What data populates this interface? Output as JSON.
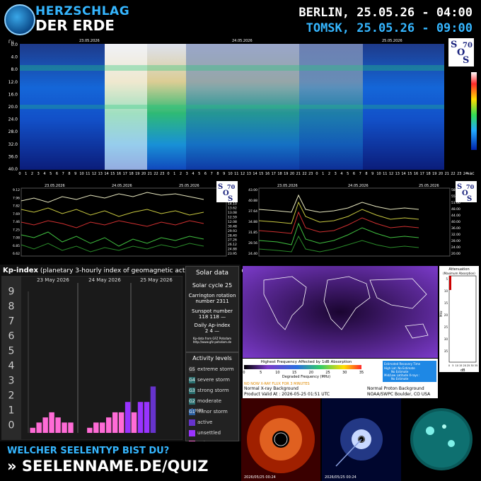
{
  "header": {
    "brand_line1": "HERZSCHLAG",
    "brand_line2": "DER ERDE",
    "berlin_time": "BERLIN, 25.05.26 - 04:00",
    "tomsk_time": "TOMSK, 25.05.26 - 09:00",
    "accent_color": "#35b6ff"
  },
  "spectrogram": {
    "y_unit": "Гц",
    "y_ticks": [
      "0.0",
      "4.0",
      "8.0",
      "12.0",
      "16.0",
      "20.0",
      "24.0",
      "28.0",
      "32.0",
      "36.0",
      "40.0"
    ],
    "x_unit": "час",
    "x_ticks": [
      "0",
      "1",
      "2",
      "3",
      "4",
      "5",
      "6",
      "7",
      "8",
      "9",
      "10",
      "11",
      "12",
      "13",
      "14",
      "15",
      "16",
      "17",
      "18",
      "19",
      "20",
      "21",
      "22",
      "23",
      "0",
      "1",
      "2",
      "3",
      "4",
      "5",
      "6",
      "7",
      "8",
      "9",
      "10",
      "11",
      "12",
      "13",
      "14",
      "15",
      "16",
      "17",
      "18",
      "19",
      "20",
      "21",
      "22",
      "23",
      "0",
      "1",
      "2",
      "3",
      "4",
      "5",
      "6",
      "7",
      "8",
      "9",
      "10",
      "11",
      "12",
      "13",
      "14",
      "15",
      "16",
      "17",
      "18",
      "19",
      "20",
      "21",
      "22",
      "23",
      "24"
    ],
    "dates": [
      "23.05.2026",
      "24.05.2026",
      "25.05.2026"
    ],
    "sos_logo": "SOS70"
  },
  "left_plot": {
    "y_left": [
      "9.12",
      "7.96",
      "7.82",
      "7.69",
      "7.46",
      "7.25",
      "7.08",
      "6.85",
      "6.62"
    ],
    "y_right": [
      "15.36",
      "15.05",
      "14.60",
      "14.10",
      "13.62",
      "13.08",
      "12.59",
      "12.08"
    ],
    "y_right2": [
      "30.48",
      "29.93",
      "28.40",
      "27.26",
      "26.12",
      "24.88",
      "23.95"
    ],
    "dates": [
      "23.05.2026",
      "24.05.2026",
      "25.05.2026"
    ]
  },
  "right_plot": {
    "y_left": [
      "43.00",
      "40.88",
      "37.64",
      "34.88",
      "31.85",
      "28.56",
      "24.40"
    ],
    "y_right": [
      "58.88",
      "55.40",
      "51.60",
      "48.00",
      "44.00",
      "40.00",
      "36.00",
      "32.00",
      "28.00",
      "24.00",
      "20.00"
    ],
    "dates": [
      "23.05.2026",
      "24.05.2026",
      "25.05.2026"
    ]
  },
  "kp": {
    "title_bold": "Kp-index",
    "title_rest": "(planetary 3-hourly index of geomagnetic activity - provisional data)",
    "levels": [
      "9",
      "8",
      "7",
      "6",
      "5",
      "4",
      "3",
      "2",
      "1",
      "0"
    ],
    "days": [
      "23 May 2026",
      "24 May 2026",
      "25 May 2026"
    ],
    "values": [
      0.33,
      0.67,
      1.0,
      1.33,
      1.0,
      0.67,
      0.67,
      0.0,
      0.0,
      0.33,
      0.67,
      0.67,
      1.0,
      1.33,
      1.33,
      2.0,
      1.33,
      2.0,
      2.0,
      3.0,
      0,
      0,
      0,
      0
    ],
    "colors": {
      "quiet": "#ff6bd6",
      "unsettled": "#9933ff",
      "active": "#6633cc"
    }
  },
  "solar": {
    "title": "Solar data",
    "cycle": "Solar cycle 25",
    "carrington": "Carrington rotation number 2311",
    "sunspot_label": "Sunspot number",
    "sunspot_vals": "118   118   —",
    "ap_label": "Daily Ap-index",
    "ap_vals": "2     4     —",
    "source": "Kp-data from GFZ Potsdam http://www.gfz-potsdam.de"
  },
  "activity": {
    "title": "Activity levels",
    "items": [
      {
        "code": "G5",
        "label": "extreme storm",
        "color": "#333"
      },
      {
        "code": "G4",
        "label": "severe storm",
        "color": "#2a6e6e"
      },
      {
        "code": "G3",
        "label": "strong storm",
        "color": "#2a6e6e"
      },
      {
        "code": "G2",
        "label": "moderate storm",
        "color": "#2a6e6e"
      },
      {
        "code": "G1",
        "label": "minor storm",
        "color": "#2a5e9e"
      },
      {
        "code": "",
        "label": "active",
        "color": "#6633cc"
      },
      {
        "code": "",
        "label": "unsettled",
        "color": "#9933ff"
      },
      {
        "code": "",
        "label": "quiet",
        "color": "#ff6bd6"
      }
    ]
  },
  "map": {
    "legend_title": "Highest Frequency Affected by 1dB Absorption",
    "axis_ticks": [
      "0",
      "5",
      "10",
      "15",
      "20",
      "25",
      "30",
      "35"
    ],
    "axis_label": "Degraded Frequency (MHz)",
    "noaa_line1": "NO NOW X-RAY FLUX FOR 3 MINUTES",
    "noaa_left1": "Normal X-ray Background",
    "noaa_right1": "Normal Proton Background",
    "product_valid": "Product Valid At : 2026-05-25 01:51 UTC",
    "noaa_right2": "NOAA/SWPC Boulder, CO USA",
    "recovery1": "Estimated Recovery Time",
    "recovery2": "High Lat: No Estimate",
    "recovery3": "No Estimate",
    "recovery4": "Mid/Low Latitude X-rays :",
    "recovery5": "No Estimate"
  },
  "attenuation": {
    "title1": "Attenuation",
    "title2": "(Maximum Absorption)",
    "y_unit": "MHz",
    "y_ticks": [
      "5",
      "10",
      "15",
      "20",
      "25",
      "30",
      "35"
    ],
    "x_ticks": [
      "0",
      "5",
      "10",
      "15",
      "20",
      "25",
      "30",
      "35"
    ],
    "x_unit": "dB"
  },
  "bottom": {
    "question": "WELCHER SEELENTYP BIST DU?",
    "link": "» SEELENNAME.DE/QUIZ"
  },
  "sun_images": [
    {
      "caption": "2026/05/25 00:24"
    },
    {
      "caption": "2026/05/25 00:24"
    },
    {
      "caption": ""
    }
  ]
}
